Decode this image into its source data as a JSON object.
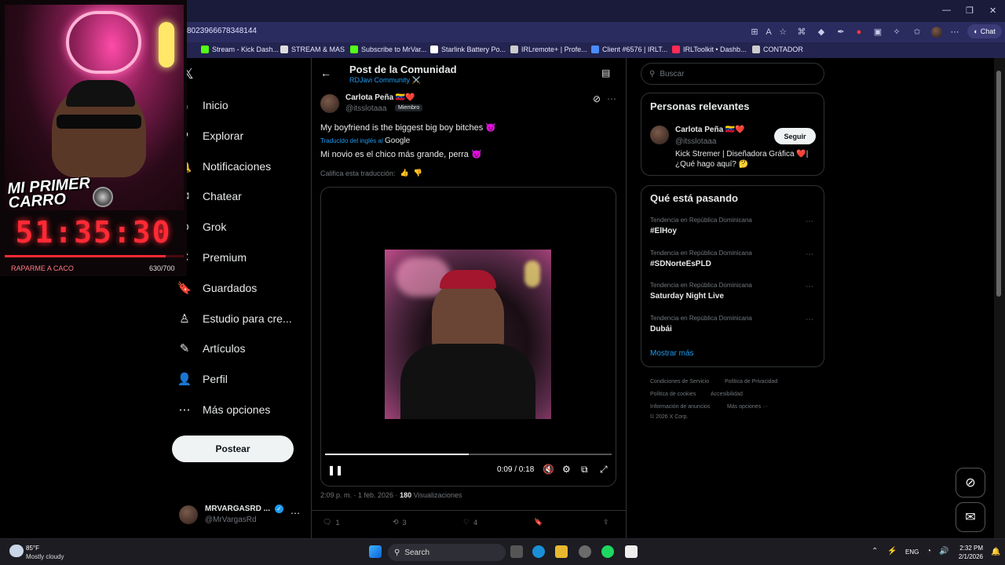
{
  "browser": {
    "url": "8023966678348144",
    "chat_label": "Chat",
    "bookmarks": [
      {
        "label": "Stream - Kick Dash...",
        "color": "#53fc18"
      },
      {
        "label": "STREAM & MAS",
        "color": "#dddddd"
      },
      {
        "label": "Subscribe to MrVar...",
        "color": "#53fc18"
      },
      {
        "label": "Starlink Battery Po...",
        "color": "#ffffff"
      },
      {
        "label": "IRLremote+ | Profe...",
        "color": "#cccccc"
      },
      {
        "label": "Client #6576 | IRLT...",
        "color": "#4a8cff"
      },
      {
        "label": "IRLToolkit • Dashb...",
        "color": "#ff2a55"
      },
      {
        "label": "CONTADOR",
        "color": "#cccccc"
      }
    ]
  },
  "overlay": {
    "title": "MI PRIMER CARRO",
    "timer": "51:35:30",
    "goal_label": "RAPARME A CACO",
    "goal_count": "630/700",
    "goal_progress": 0.9
  },
  "nav": {
    "items": [
      {
        "label": "Inicio",
        "icon": "home-icon",
        "glyph": "⌂"
      },
      {
        "label": "Explorar",
        "icon": "search-icon",
        "glyph": "⚲"
      },
      {
        "label": "Notificaciones",
        "icon": "bell-icon",
        "glyph": "🔔"
      },
      {
        "label": "Chatear",
        "icon": "mail-icon",
        "glyph": "✉"
      },
      {
        "label": "Grok",
        "icon": "grok-icon",
        "glyph": "⊘"
      },
      {
        "label": "Premium",
        "icon": "x-icon",
        "glyph": "✕"
      },
      {
        "label": "Guardados",
        "icon": "bookmark-icon",
        "glyph": "🔖"
      },
      {
        "label": "Estudio para cre...",
        "icon": "studio-icon",
        "glyph": "♙"
      },
      {
        "label": "Artículos",
        "icon": "article-icon",
        "glyph": "✎"
      },
      {
        "label": "Perfil",
        "icon": "profile-icon",
        "glyph": "👤"
      },
      {
        "label": "Más opciones",
        "icon": "more-icon",
        "glyph": "⋯"
      }
    ],
    "post_button": "Postear",
    "account": {
      "name": "MRVARGASRD ...",
      "handle": "@MrVargasRd"
    }
  },
  "post": {
    "header_title": "Post de la Comunidad",
    "community": "RDJavi Community ⚔️",
    "author_name": "Carlota Peña 🇻🇪❤️",
    "author_handle": "@itsslotaaa",
    "member_badge": "Miembro",
    "text": "My boyfriend is the biggest big boy bitches 😈",
    "translated_from": "Traducido del inglés al",
    "translator": "Google",
    "translation": "Mi novio es el chico más grande, perra 😈",
    "rate_translation": "Califica esta traducción:",
    "video_time": "0:09 / 0:18",
    "video_progress": 0.5,
    "timestamp": "2:09 p. m. · 1 feb. 2026 ·",
    "views_count": "180",
    "views_label": "Visualizaciones",
    "replies": "1",
    "reposts": "3",
    "likes": "4"
  },
  "sidebar": {
    "search_placeholder": "Buscar",
    "relevant_title": "Personas relevantes",
    "person": {
      "name": "Carlota Peña 🇻🇪❤️",
      "handle": "@itsslotaaa",
      "bio": "Kick Stremer | Diseñadora Gráfica ❤️| ¿Qué hago aquí? 🤔",
      "follow": "Seguir"
    },
    "trends_title": "Qué está pasando",
    "trends": [
      {
        "category": "Tendencia en República Dominicana",
        "name": "#ElHoy"
      },
      {
        "category": "Tendencia en República Dominicana",
        "name": "#SDNorteEsPLD"
      },
      {
        "category": "Tendencia en República Dominicana",
        "name": "Saturday Night Live"
      },
      {
        "category": "Tendencia en República Dominicana",
        "name": "Dubái"
      }
    ],
    "show_more": "Mostrar más",
    "footer": [
      "Condiciones de Servicio",
      "Política de Privacidad",
      "Política de cookies",
      "Accesibilidad",
      "Información de anuncios",
      "Más opciones ···",
      "© 2026 X Corp."
    ]
  },
  "taskbar": {
    "weather_temp": "85°F",
    "weather_desc": "Mostly cloudy",
    "search_label": "Search",
    "lang": "ENG",
    "time": "2:32 PM",
    "date": "2/1/2026"
  }
}
